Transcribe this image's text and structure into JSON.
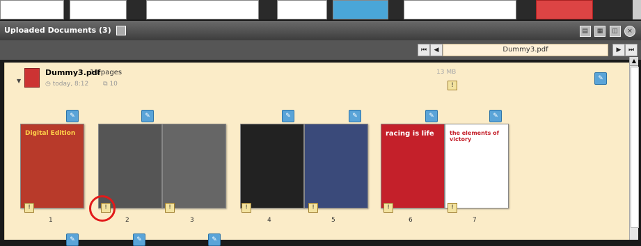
{
  "panel": {
    "title": "Uploaded Documents (3)",
    "current_file": "Dummy3.pdf"
  },
  "icons": {
    "collapse": "collapse-icon",
    "view": "view-icon",
    "settings": "settings-icon",
    "close": "close-icon",
    "first": "first-page-icon",
    "prev": "prev-page-icon",
    "next": "next-page-icon",
    "last": "last-page-icon",
    "edit": "edit-icon",
    "warning": "warning-icon"
  },
  "document": {
    "name": "Dummy3.pdf",
    "page_count": "10 pages",
    "uploaded": "today, 8:12",
    "versions": "10",
    "size": "13 MB"
  },
  "pages": [
    {
      "num": "1",
      "title": "Digital Edition"
    },
    {
      "num": "2",
      "title": ""
    },
    {
      "num": "3",
      "title": ""
    },
    {
      "num": "4",
      "title": ""
    },
    {
      "num": "5",
      "title": ""
    },
    {
      "num": "6",
      "title": "racing is life"
    },
    {
      "num": "7",
      "title": "the elements of victory"
    }
  ],
  "colors": {
    "accent_blue": "#5aa4d8",
    "panel_bg": "#fbecc8",
    "highlight": "#e21a1a"
  }
}
